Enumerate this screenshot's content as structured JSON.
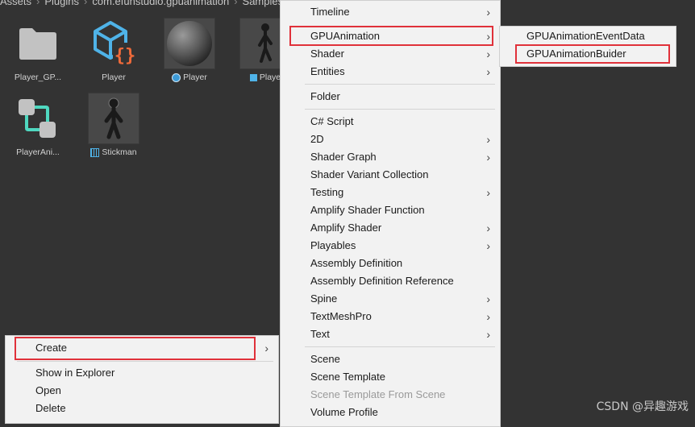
{
  "breadcrumb": [
    "Assets",
    "Plugins",
    "com.efunstudio.gpuanimation",
    "Samples"
  ],
  "breadcrumb_separator": "›",
  "assets": [
    {
      "label": "Player_GP...",
      "icon": "folder-icon"
    },
    {
      "label": "Player",
      "icon": "prefab-variant-icon"
    },
    {
      "label": "Player",
      "icon": "material-sphere-icon"
    },
    {
      "label": "Playe",
      "icon": "prefab-model-icon"
    },
    {
      "label": "PlayerAni...",
      "icon": "animator-controller-icon"
    },
    {
      "label": "Stickman",
      "icon": "mesh-icon"
    }
  ],
  "context_menu": {
    "items": [
      {
        "label": "Create",
        "arrow": "›"
      },
      {
        "label": "Show in Explorer"
      },
      {
        "label": "Open"
      },
      {
        "label": "Delete"
      }
    ]
  },
  "create_menu": {
    "items": [
      {
        "label": "Timeline",
        "arrow": "›"
      },
      {
        "label": "GPUAnimation",
        "arrow": "›"
      },
      {
        "label": "Shader",
        "arrow": "›"
      },
      {
        "label": "Entities",
        "arrow": "›"
      },
      {
        "label": "Folder"
      },
      {
        "label": "C# Script"
      },
      {
        "label": "2D",
        "arrow": "›"
      },
      {
        "label": "Shader Graph",
        "arrow": "›"
      },
      {
        "label": "Shader Variant Collection"
      },
      {
        "label": "Testing",
        "arrow": "›"
      },
      {
        "label": "Amplify Shader Function"
      },
      {
        "label": "Amplify Shader",
        "arrow": "›"
      },
      {
        "label": "Playables",
        "arrow": "›"
      },
      {
        "label": "Assembly Definition"
      },
      {
        "label": "Assembly Definition Reference"
      },
      {
        "label": "Spine",
        "arrow": "›"
      },
      {
        "label": "TextMeshPro",
        "arrow": "›"
      },
      {
        "label": "Text",
        "arrow": "›"
      },
      {
        "label": "Scene"
      },
      {
        "label": "Scene Template"
      },
      {
        "label": "Scene Template From Scene",
        "disabled": true
      },
      {
        "label": "Volume Profile"
      }
    ]
  },
  "gpuanimation_menu": {
    "items": [
      {
        "label": "GPUAnimationEventData"
      },
      {
        "label": "GPUAnimationBuider"
      }
    ]
  },
  "colors": {
    "highlight": "#e0313a",
    "menu_bg": "#f2f2f2",
    "panel_bg": "#333333"
  },
  "watermark": "CSDN @异趣游戏"
}
